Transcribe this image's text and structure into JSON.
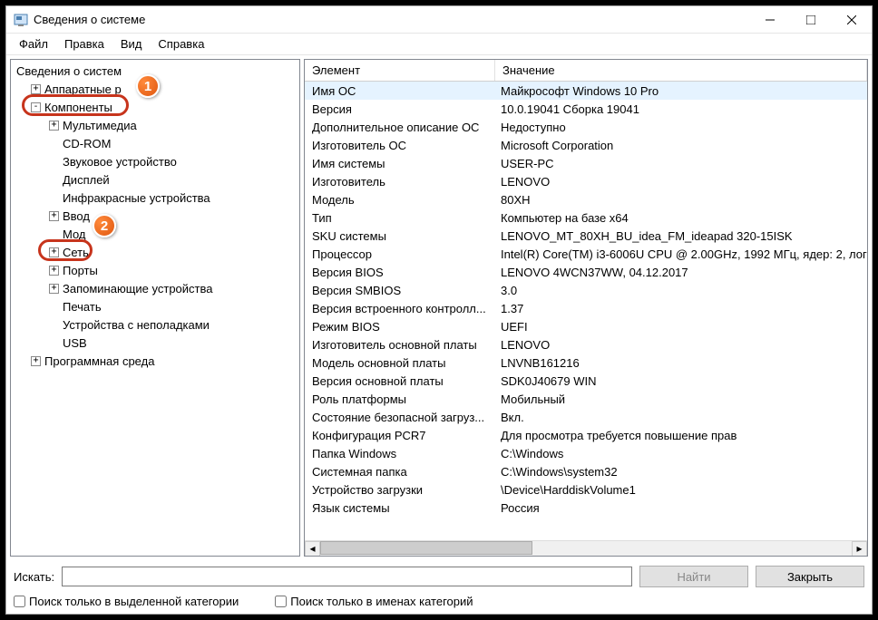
{
  "window": {
    "title": "Сведения о системе"
  },
  "menu": {
    "file": "Файл",
    "edit": "Правка",
    "view": "Вид",
    "help": "Справка"
  },
  "tree": {
    "root": "Сведения о систем",
    "hardware": "Аппаратные р",
    "components": "Компоненты",
    "multimedia": "Мультимедиа",
    "cdrom": "CD-ROM",
    "sound": "Звуковое устройство",
    "display": "Дисплей",
    "infrared": "Инфракрасные устройства",
    "input": "Ввод",
    "mod": "Мод",
    "network": "Сеть",
    "ports": "Порты",
    "storage": "Запоминающие устройства",
    "print": "Печать",
    "problem_devices": "Устройства с неполадками",
    "usb": "USB",
    "software_env": "Программная среда"
  },
  "badges": {
    "one": "1",
    "two": "2"
  },
  "columns": {
    "element": "Элемент",
    "value": "Значение"
  },
  "rows": [
    {
      "k": "Имя ОС",
      "v": "Майкрософт Windows 10 Pro"
    },
    {
      "k": "Версия",
      "v": "10.0.19041 Сборка 19041"
    },
    {
      "k": "Дополнительное описание ОС",
      "v": "Недоступно"
    },
    {
      "k": "Изготовитель ОС",
      "v": "Microsoft Corporation"
    },
    {
      "k": "Имя системы",
      "v": "USER-PC"
    },
    {
      "k": "Изготовитель",
      "v": "LENOVO"
    },
    {
      "k": "Модель",
      "v": "80XH"
    },
    {
      "k": "Тип",
      "v": "Компьютер на базе x64"
    },
    {
      "k": "SKU системы",
      "v": "LENOVO_MT_80XH_BU_idea_FM_ideapad 320-15ISK"
    },
    {
      "k": "Процессор",
      "v": "Intel(R) Core(TM) i3-6006U CPU @ 2.00GHz, 1992 МГц, ядер: 2, логи"
    },
    {
      "k": "Версия BIOS",
      "v": "LENOVO 4WCN37WW, 04.12.2017"
    },
    {
      "k": "Версия SMBIOS",
      "v": "3.0"
    },
    {
      "k": "Версия встроенного контролл...",
      "v": "1.37"
    },
    {
      "k": "Режим BIOS",
      "v": "UEFI"
    },
    {
      "k": "Изготовитель основной платы",
      "v": "LENOVO"
    },
    {
      "k": "Модель основной платы",
      "v": "LNVNB161216"
    },
    {
      "k": "Версия основной платы",
      "v": "SDK0J40679 WIN"
    },
    {
      "k": "Роль платформы",
      "v": "Мобильный"
    },
    {
      "k": "Состояние безопасной загруз...",
      "v": "Вкл."
    },
    {
      "k": "Конфигурация PCR7",
      "v": "Для просмотра требуется повышение прав"
    },
    {
      "k": "Папка Windows",
      "v": "C:\\Windows"
    },
    {
      "k": "Системная папка",
      "v": "C:\\Windows\\system32"
    },
    {
      "k": "Устройство загрузки",
      "v": "\\Device\\HarddiskVolume1"
    },
    {
      "k": "Язык системы",
      "v": "Россия"
    }
  ],
  "search": {
    "label": "Искать:",
    "placeholder": "",
    "find": "Найти",
    "close": "Закрыть",
    "only_selected": "Поиск только в выделенной категории",
    "only_names": "Поиск только в именах категорий"
  }
}
